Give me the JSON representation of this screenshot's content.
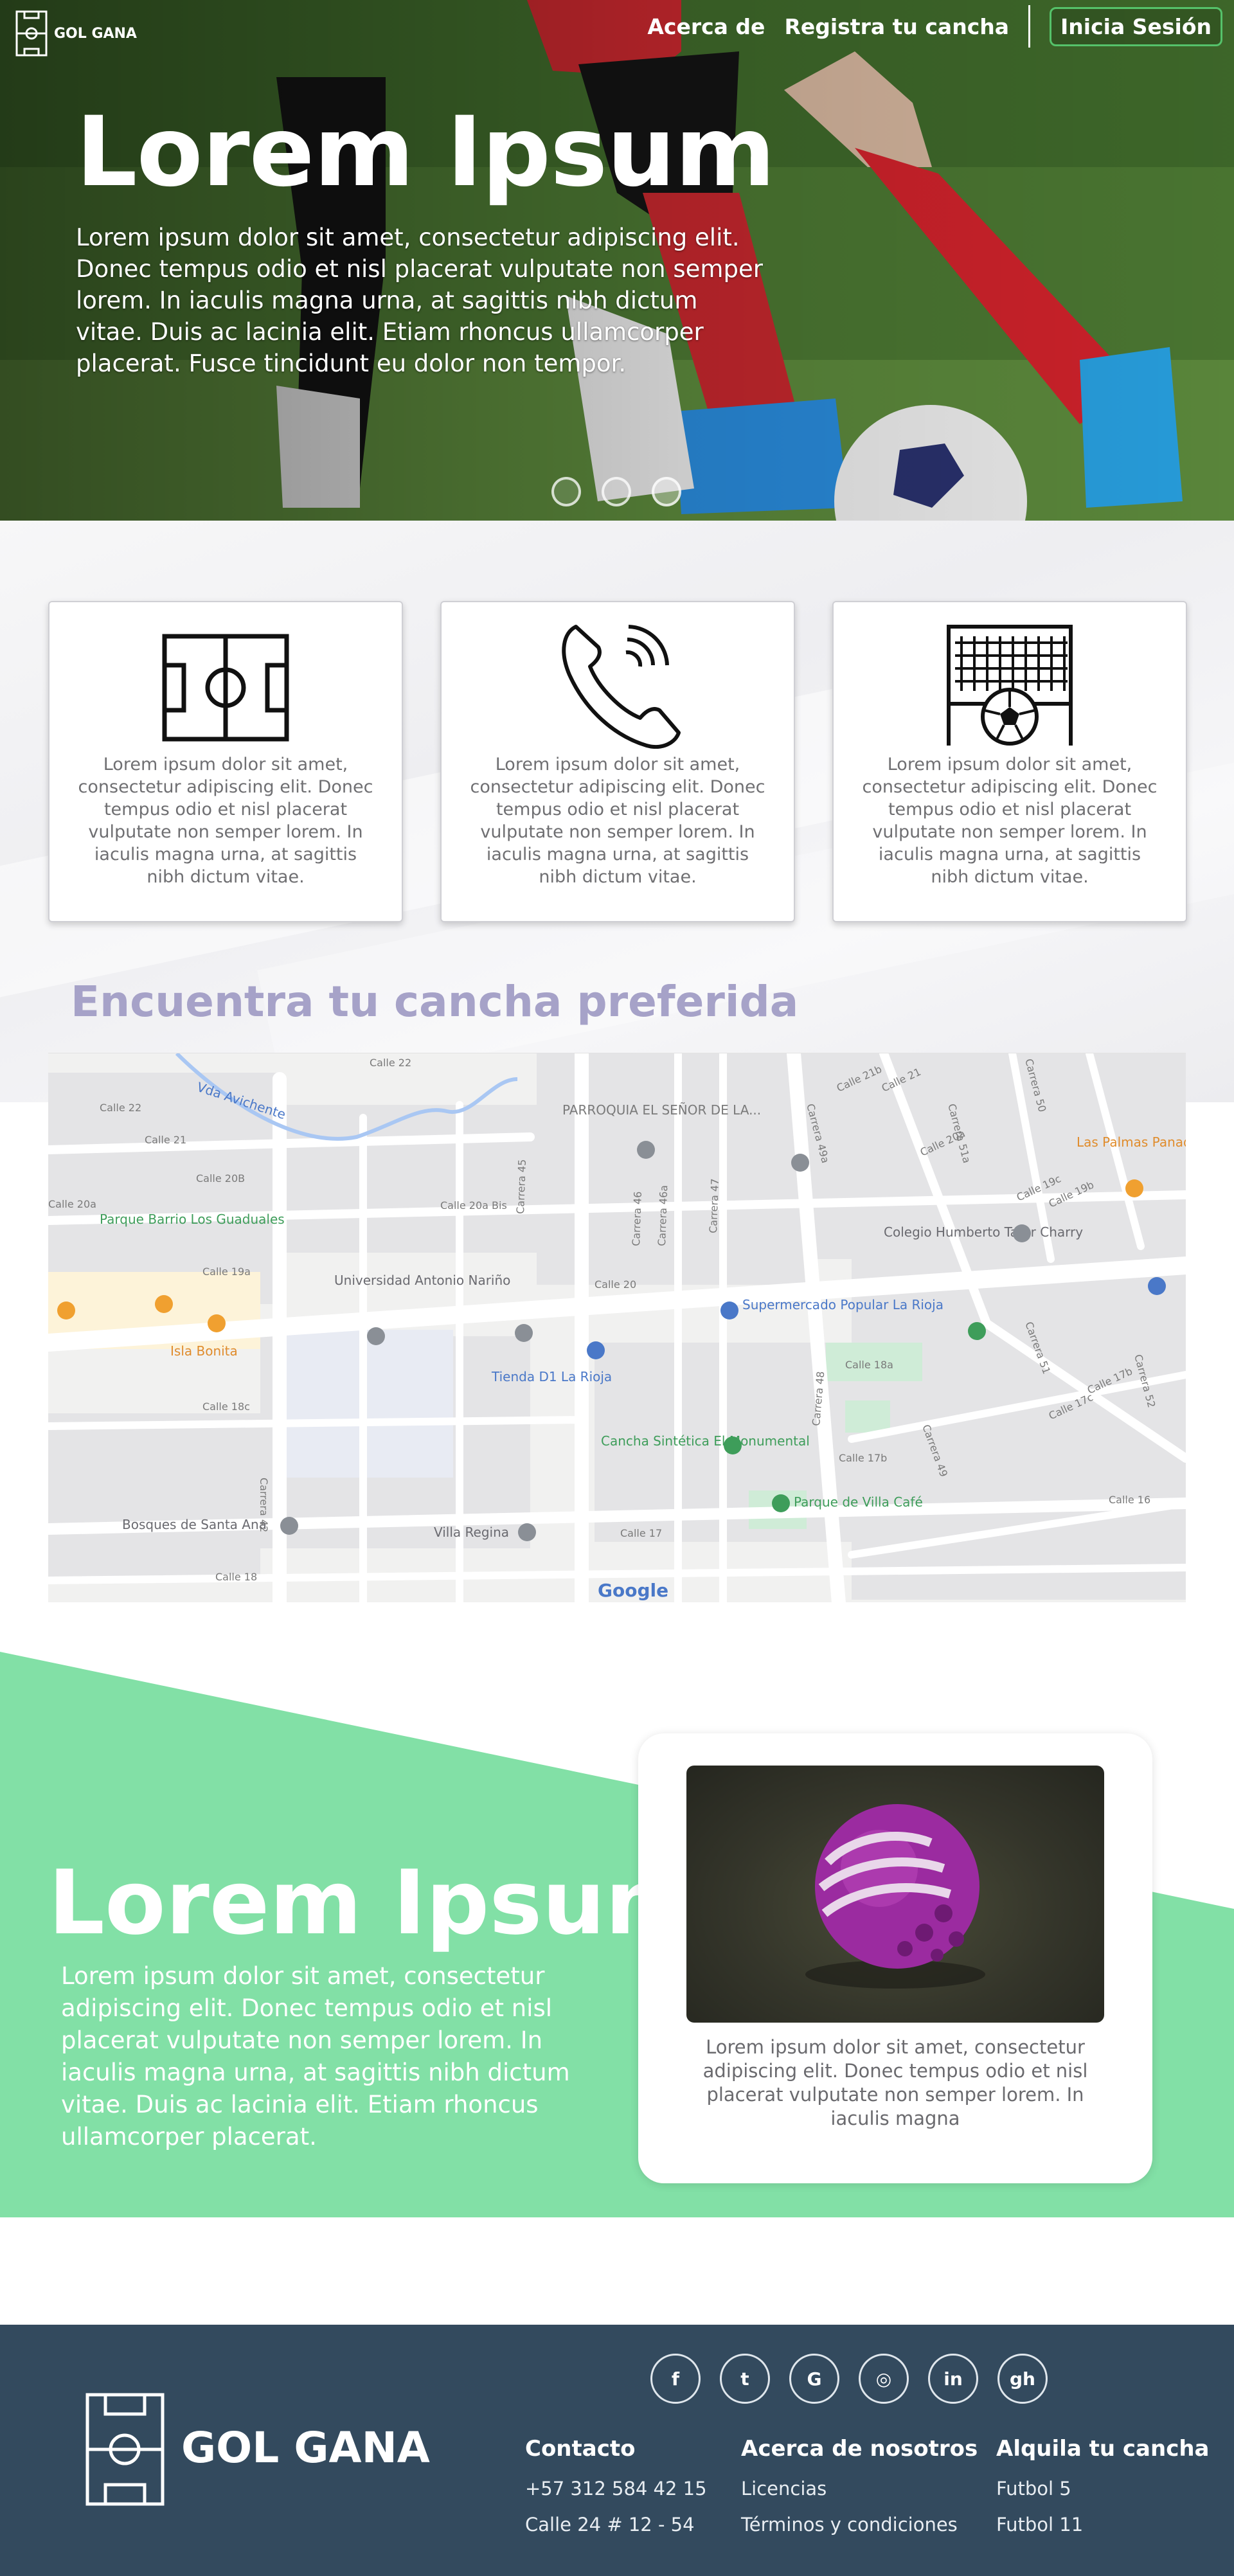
{
  "header": {
    "brand": "GOL GANA",
    "nav": [
      "Acerca de",
      "Registra tu cancha"
    ],
    "login_label": "Inicia Sesión"
  },
  "hero": {
    "title": "Lorem Ipsum",
    "text": "Lorem ipsum dolor sit amet, consectetur adipiscing elit. Donec tempus odio et nisl placerat vulputate non semper lorem. In iaculis magna urna, at sagittis nibh dictum vitae. Duis ac lacinia elit. Etiam rhoncus ullamcorper placerat. Fusce tincidunt eu dolor non tempor.",
    "slides": 3,
    "active_slide": 1
  },
  "features": [
    {
      "icon": "soccer-field-icon",
      "text": "Lorem ipsum dolor sit amet, consectetur adipiscing elit. Donec tempus odio et nisl placerat vulputate non semper lorem. In iaculis magna urna, at sagittis nibh dictum vitae."
    },
    {
      "icon": "phone-icon",
      "text": "Lorem ipsum dolor sit amet, consectetur adipiscing elit. Donec tempus odio et nisl placerat vulputate non semper lorem. In iaculis magna urna, at sagittis nibh dictum vitae."
    },
    {
      "icon": "goal-ball-icon",
      "text": "Lorem ipsum dolor sit amet, consectetur adipiscing elit. Donec tempus odio et nisl placerat vulputate non semper lorem. In iaculis magna urna, at sagittis nibh dictum vitae."
    }
  ],
  "map": {
    "title": "Encuentra tu cancha preferida",
    "labels": {
      "avichente": "Vda Avichente",
      "parroquia": "PARROQUIA EL SEÑOR DE LA...",
      "las_palmas": "Las Palmas Panadería Pastelería",
      "parque_barrio": "Parque Barrio Los Guaduales",
      "colegio": "Colegio Humberto Tafur Charry",
      "universidad": "Universidad Antonio Nariño",
      "supermercado": "Supermercado Popular La Rioja",
      "isla_bonita": "Isla Bonita",
      "tienda": "Tienda D1 La Rioja",
      "cancha": "Cancha Sintética El Monumental",
      "parque_villa": "Parque de Villa Café",
      "bosques": "Bosques de Santa Ana",
      "villa_regina": "Villa Regina",
      "google": "Google",
      "streets": [
        "Calle 22",
        "Calle 21",
        "Calle 20B",
        "Calle 20a",
        "Calle 20a Bis",
        "Calle 19a",
        "Calle 20",
        "Calle 18c",
        "Calle 18",
        "Calle 17",
        "Calle 18a",
        "Calle 17b",
        "Calle 16",
        "Carrera 42",
        "Carrera 45",
        "Carrera 46",
        "Carrera 46a",
        "Carrera 47",
        "Carrera 48",
        "Carrera 49",
        "Carrera 51",
        "Carrera 52",
        "Calle 21b",
        "Calle 21",
        "Calle 20a",
        "Calle 19c",
        "Calle 19b",
        "Calle 17c",
        "Calle 17b",
        "Carrera 51a",
        "Carrera 49a",
        "Carrera 50",
        "Calle 22"
      ]
    }
  },
  "promo": {
    "title": "Lorem Ipsum",
    "text": "Lorem ipsum dolor sit amet, consectetur adipiscing elit. Donec tempus odio et nisl placerat vulputate non semper lorem. In iaculis magna urna, at sagittis nibh dictum vitae. Duis ac lacinia elit. Etiam rhoncus ullamcorper placerat.",
    "card_text": "Lorem ipsum dolor sit amet, consectetur adipiscing elit. Donec tempus odio et nisl placerat vulputate non semper lorem. In iaculis magna"
  },
  "footer": {
    "brand": "GOL GANA",
    "socials": [
      "f",
      "t",
      "G",
      "◎",
      "in",
      "gh"
    ],
    "columns": [
      {
        "heading": "Contacto",
        "items": [
          "+57 312 584 42 15",
          "Calle 24 # 12 - 54"
        ]
      },
      {
        "heading": "Acerca de nosotros",
        "items": [
          "Licencias",
          "Términos y condiciones"
        ]
      },
      {
        "heading": "Alquila tu cancha",
        "items": [
          "Futbol 5",
          "Futbol 11"
        ]
      }
    ]
  },
  "colors": {
    "green": "#82e0a6",
    "footer": "#334a5e",
    "map_title": "#a6a2c8",
    "login_border": "#55c26a"
  }
}
